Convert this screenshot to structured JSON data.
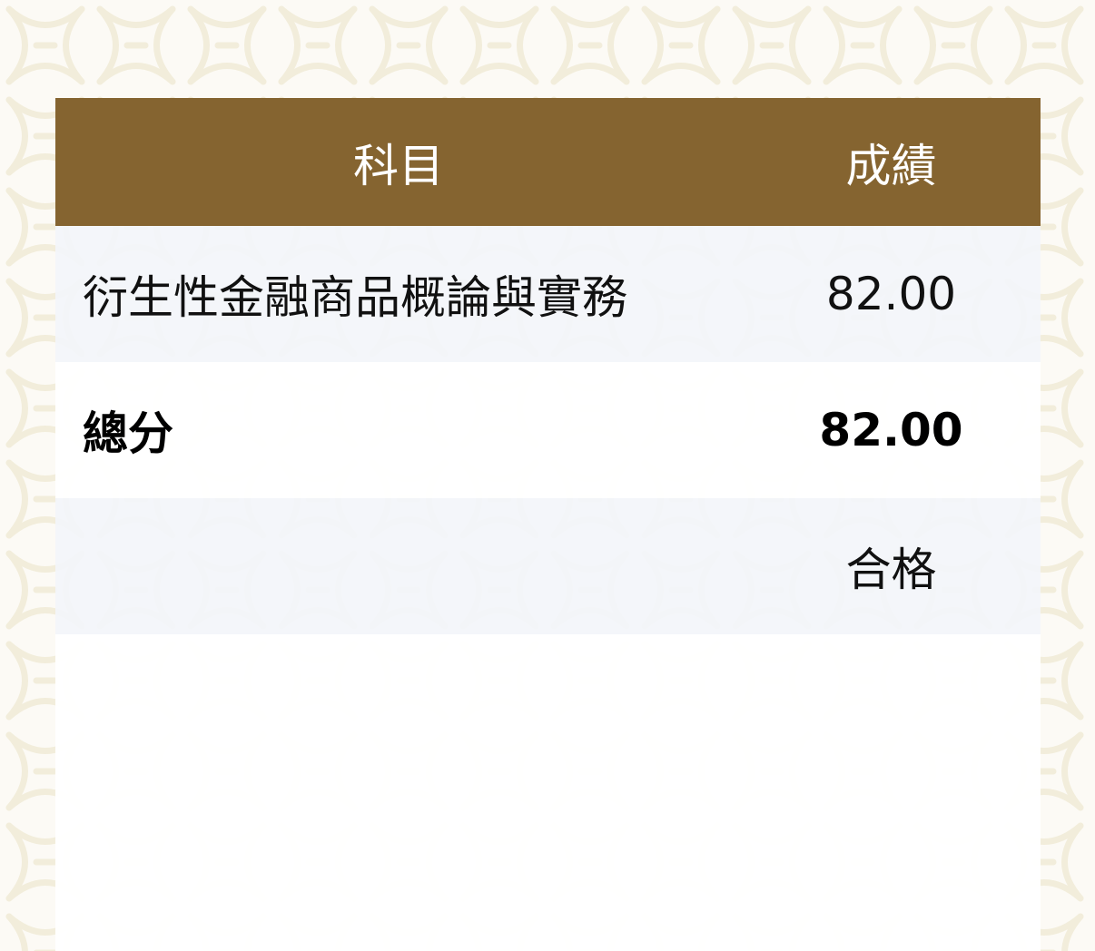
{
  "table": {
    "header": {
      "subject": "科目",
      "score": "成績"
    },
    "rows": [
      {
        "subject": "衍生性金融商品概論與實務",
        "score": "82.00"
      }
    ],
    "total": {
      "label": "總分",
      "score": "82.00"
    },
    "result": {
      "label": "",
      "value": "合格"
    }
  },
  "colors": {
    "header_background": "#856430",
    "header_text": "#ffffff",
    "row_background": "#f3f5fa",
    "pattern": "#ece4c8"
  }
}
